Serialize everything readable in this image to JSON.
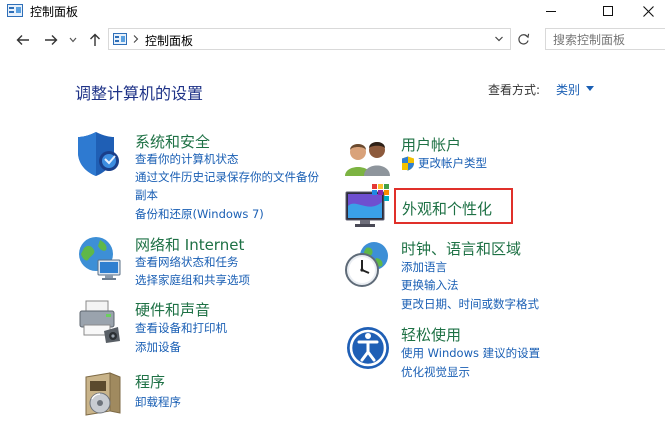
{
  "window": {
    "title": "控制面板"
  },
  "nav": {
    "breadcrumb": "控制面板",
    "search_placeholder": "搜索控制面板"
  },
  "main": {
    "heading": "调整计算机的设置",
    "view_by_label": "查看方式:",
    "view_by_value": "类别"
  },
  "categories": {
    "system_security": {
      "title": "系统和安全",
      "links": [
        "查看你的计算机状态",
        "通过文件历史记录保存你的文件备份",
        "副本",
        "备份和还原(Windows 7)"
      ]
    },
    "network": {
      "title": "网络和 Internet",
      "links": [
        "查看网络状态和任务",
        "选择家庭组和共享选项"
      ]
    },
    "hardware": {
      "title": "硬件和声音",
      "links": [
        "查看设备和打印机",
        "添加设备"
      ]
    },
    "programs": {
      "title": "程序",
      "links": [
        "卸载程序"
      ]
    },
    "user_accounts": {
      "title": "用户帐户",
      "links": [
        "更改帐户类型"
      ]
    },
    "appearance": {
      "title": "外观和个性化",
      "links": []
    },
    "clock_region": {
      "title": "时钟、语言和区域",
      "links": [
        "添加语言",
        "更换输入法",
        "更改日期、时间或数字格式"
      ]
    },
    "ease_of_access": {
      "title": "轻松使用",
      "links": [
        "使用 Windows 建议的设置",
        "优化视觉显示"
      ]
    }
  },
  "colors": {
    "category_title": "#1e7145",
    "link": "#1a5fb4",
    "heading": "#1e3287",
    "highlight": "#e0302a"
  },
  "icons": {
    "titlebar": "control-panel-icon",
    "back": "arrow-left-icon",
    "forward": "arrow-right-icon",
    "recent": "chevron-down-icon",
    "up": "arrow-up-icon",
    "refresh": "refresh-icon",
    "minimize": "minimize-icon",
    "maximize": "maximize-icon",
    "close": "close-icon",
    "system_security": "shield-icon",
    "network": "network-globe-icon",
    "hardware": "printer-icon",
    "programs": "disc-box-icon",
    "user_accounts": "users-icon",
    "uac": "uac-shield-icon",
    "appearance": "monitor-palette-icon",
    "clock_region": "clock-globe-icon",
    "ease_of_access": "accessibility-icon"
  }
}
